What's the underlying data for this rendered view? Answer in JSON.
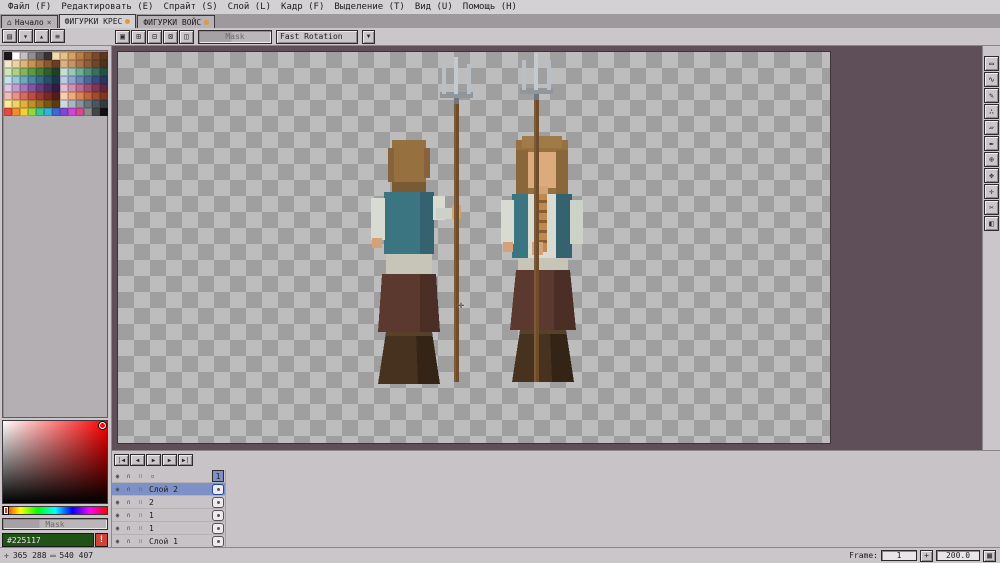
{
  "theme": {
    "panel_bg": "#cac6ca",
    "selection_accent": "#7e91c7",
    "canvas_outside": "#5e4f58",
    "checker_dark": "#9f9f9f",
    "checker_light": "#bdbdbd",
    "modified_dot": "#e09a3c",
    "foreground_color": "#225117",
    "warning_red": "#cf4436"
  },
  "menu": {
    "items": [
      "Файл (F)",
      "Редактировать (E)",
      "Спрайт (S)",
      "Слой (L)",
      "Кадр (F)",
      "Выделение (T)",
      "Вид (U)",
      "Помощь (H)"
    ]
  },
  "tab_icons": {
    "home_glyph": "⌂",
    "close_glyph": "×"
  },
  "tabs": [
    {
      "label": "Начало",
      "active": false,
      "modified": false
    },
    {
      "label": "ФИГУРКИ КРЕС",
      "active": true,
      "modified": true
    },
    {
      "label": "ФИГУРКИ ВОЙС",
      "active": false,
      "modified": true
    }
  ],
  "toolbar": {
    "palette_buttons": [
      {
        "name": "palette-lock",
        "glyph": "▤"
      },
      {
        "name": "palette-sort",
        "glyph": "▾"
      },
      {
        "name": "palette-presets",
        "glyph": "▴"
      },
      {
        "name": "palette-options",
        "glyph": "≡"
      }
    ],
    "selection_buttons": [
      {
        "name": "selection-replace",
        "glyph": "▣"
      },
      {
        "name": "selection-add",
        "glyph": "⊞"
      },
      {
        "name": "selection-subtract",
        "glyph": "⊟"
      },
      {
        "name": "selection-intersect",
        "glyph": "⊠"
      },
      {
        "name": "selection-options",
        "glyph": "◫"
      }
    ],
    "mask_label": "Mask",
    "rotation_value": "Fast Rotation",
    "dropdown_glyph": "▼"
  },
  "palette": {
    "colors": [
      "#1b161b",
      "#ffffff",
      "#c3bfc3",
      "#918d91",
      "#615e61",
      "#353235",
      "#f3dcae",
      "#e9c184",
      "#d7a25e",
      "#bb7f44",
      "#9c6233",
      "#7c4a26",
      "#5c371c",
      "#f6e8cd",
      "#ecd3a3",
      "#ddb679",
      "#c89455",
      "#ab733d",
      "#8b572e",
      "#693f22",
      "#dcb183",
      "#c99465",
      "#ad764a",
      "#8f5c38",
      "#6f4628",
      "#50321c",
      "#d3e6b5",
      "#aed184",
      "#83b65c",
      "#5e9a42",
      "#447d34",
      "#2f5f2c",
      "#204224",
      "#c4e0d2",
      "#97c9b3",
      "#6daf94",
      "#4d9077",
      "#35715c",
      "#225243",
      "#c6e2e8",
      "#97c8d4",
      "#6ba9bd",
      "#4a89a4",
      "#356b88",
      "#25506a",
      "#19374c",
      "#bccae4",
      "#90a6d2",
      "#6a86ba",
      "#4c679e",
      "#374d80",
      "#263561",
      "#ddc8e4",
      "#c19ed2",
      "#a278bc",
      "#8256a0",
      "#643c82",
      "#482a62",
      "#2f1b44",
      "#e4bcd2",
      "#d192b2",
      "#ba6c92",
      "#9e4e72",
      "#803756",
      "#60263e",
      "#f4bcb6",
      "#e9928a",
      "#d86a62",
      "#bd4c46",
      "#9b3833",
      "#782825",
      "#571b19",
      "#f6cfab",
      "#eeab7c",
      "#df8553",
      "#c46438",
      "#a34b28",
      "#7f381d",
      "#f8ec96",
      "#efd366",
      "#ddb242",
      "#c38f2a",
      "#a26f1e",
      "#7e5414",
      "#5a3d0f",
      "#d2d9dd",
      "#acb6bd",
      "#87929b",
      "#67737b",
      "#4b555d",
      "#323b41",
      "#e8483f",
      "#f28c2e",
      "#f5ce33",
      "#96d838",
      "#35cc8c",
      "#2fb5d8",
      "#3b67d8",
      "#7a49d8",
      "#c948d8",
      "#d84890",
      "#8c8c8c",
      "#464646",
      "#101010"
    ]
  },
  "picker": {
    "mask_label": "Mask",
    "hex": "#225117",
    "warning_glyph": "!"
  },
  "tools": [
    {
      "name": "marquee-tool",
      "glyph": "▭"
    },
    {
      "name": "lasso-tool",
      "glyph": "∿"
    },
    {
      "name": "pencil-tool",
      "glyph": "✎"
    },
    {
      "name": "spray-tool",
      "glyph": "∴"
    },
    {
      "name": "eraser-tool",
      "glyph": "▱"
    },
    {
      "name": "eyedropper-tool",
      "glyph": "✒"
    },
    {
      "name": "zoom-tool",
      "glyph": "⊕"
    },
    {
      "name": "hand-tool",
      "glyph": "✥"
    },
    {
      "name": "move-tool",
      "glyph": "✛"
    },
    {
      "name": "slice-tool",
      "glyph": "✂"
    },
    {
      "name": "bucket-tool",
      "glyph": "◧"
    }
  ],
  "canvas": {
    "cursor_glyph": "✛"
  },
  "timeline": {
    "playback": [
      {
        "name": "first-frame",
        "glyph": "|◀"
      },
      {
        "name": "prev-frame",
        "glyph": "◀"
      },
      {
        "name": "play",
        "glyph": "▶"
      },
      {
        "name": "next-frame",
        "glyph": "▶"
      },
      {
        "name": "last-frame",
        "glyph": "▶|"
      }
    ],
    "icons": {
      "eye": "◉",
      "lock": "∩",
      "cont": "∷",
      "extra": "▫"
    },
    "frame_header": "1",
    "layers": [
      {
        "name": "Слой 2",
        "selected": true
      },
      {
        "name": "2",
        "selected": false
      },
      {
        "name": "1",
        "selected": false
      },
      {
        "name": "1",
        "selected": false
      },
      {
        "name": "Слой 1",
        "selected": false
      }
    ]
  },
  "status": {
    "pos_icon": "✛",
    "position": "365 288",
    "size_icon": "▭",
    "size": "540 407",
    "frame_label": "Frame:",
    "frame_value": "1",
    "plus_label": "+",
    "zoom": "200.0",
    "grid_glyph": "▦"
  }
}
